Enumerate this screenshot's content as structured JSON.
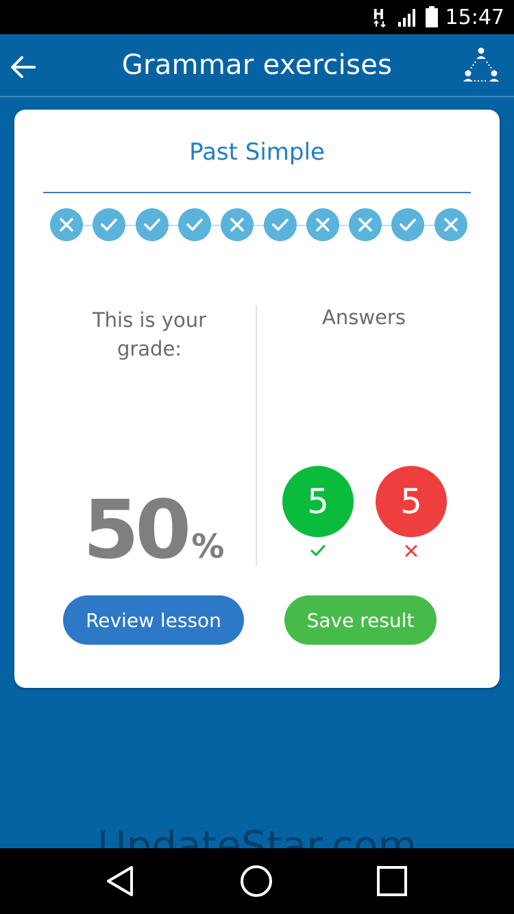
{
  "status_bar": {
    "time": "15:47",
    "network_badge": "H",
    "icons": [
      "network-h-icon",
      "signal-icon",
      "battery-icon"
    ]
  },
  "app_bar": {
    "title": "Grammar exercises",
    "icons": [
      "back-arrow-icon",
      "group-icon"
    ]
  },
  "card": {
    "lesson_title": "Past Simple",
    "progress": [
      "wrong",
      "correct",
      "correct",
      "correct",
      "wrong",
      "correct",
      "wrong",
      "wrong",
      "correct",
      "wrong"
    ],
    "grade_label": "This is your grade:",
    "grade_value": "50",
    "grade_unit": "%",
    "answers_label": "Answers",
    "correct_count": "5",
    "wrong_count": "5",
    "buttons": {
      "review": "Review lesson",
      "save": "Save result"
    }
  },
  "watermark": "UpdateStar.com",
  "nav_bar": {
    "icons": [
      "back-triangle-icon",
      "home-circle-icon",
      "recents-square-icon"
    ]
  },
  "colors": {
    "primary": "#0563a4",
    "accent_title": "#1f7fc4",
    "progress_dot": "#5ab3da",
    "correct": "#0bbb3c",
    "wrong": "#ef3e3e",
    "review_button": "#2e78c8",
    "save_button": "#47bb4a"
  }
}
